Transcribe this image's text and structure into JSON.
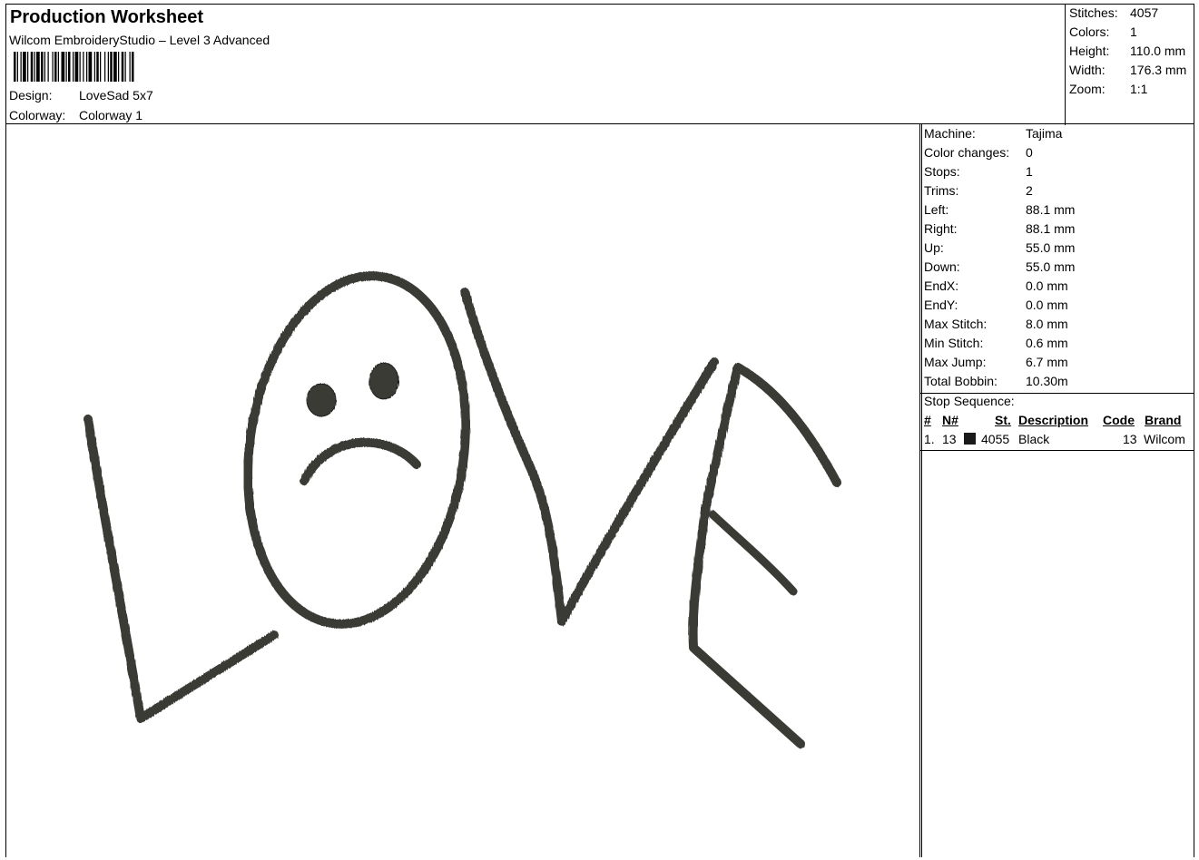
{
  "header": {
    "title": "Production Worksheet",
    "software": "Wilcom EmbroideryStudio – Level 3 Advanced",
    "design_label": "Design:",
    "design_value": "LoveSad 5x7",
    "colorway_label": "Colorway:",
    "colorway_value": "Colorway 1"
  },
  "stats": [
    {
      "label": "Stitches:",
      "value": "4057"
    },
    {
      "label": "Colors:",
      "value": "1"
    },
    {
      "label": "Height:",
      "value": "110.0 mm"
    },
    {
      "label": "Width:",
      "value": "176.3 mm"
    },
    {
      "label": "Zoom:",
      "value": "1:1"
    }
  ],
  "machine_info": [
    {
      "label": "Machine:",
      "value": "Tajima"
    },
    {
      "label": "Color changes:",
      "value": "0"
    },
    {
      "label": "Stops:",
      "value": "1"
    },
    {
      "label": "Trims:",
      "value": "2"
    },
    {
      "label": "Left:",
      "value": "88.1 mm"
    },
    {
      "label": "Right:",
      "value": "88.1 mm"
    },
    {
      "label": "Up:",
      "value": "55.0 mm"
    },
    {
      "label": "Down:",
      "value": "55.0 mm"
    },
    {
      "label": "EndX:",
      "value": "0.0 mm"
    },
    {
      "label": "EndY:",
      "value": "0.0 mm"
    },
    {
      "label": "Max Stitch:",
      "value": "8.0 mm"
    },
    {
      "label": "Min Stitch:",
      "value": "0.6 mm"
    },
    {
      "label": "Max Jump:",
      "value": "6.7 mm"
    },
    {
      "label": "Total Bobbin:",
      "value": "10.30m"
    }
  ],
  "stop_sequence": {
    "title": "Stop Sequence:",
    "headers": [
      "#",
      "N#",
      "St.",
      "Description",
      "Code",
      "Brand"
    ],
    "rows": [
      {
        "index": "1.",
        "needle": "13",
        "swatch_color": "#1a1a1a",
        "stitches": "4055",
        "description": "Black",
        "code": "13",
        "brand": "Wilcom"
      }
    ]
  },
  "design_colors": {
    "thread": "#3a3a36",
    "thread_edge": "#1e1e1c"
  }
}
